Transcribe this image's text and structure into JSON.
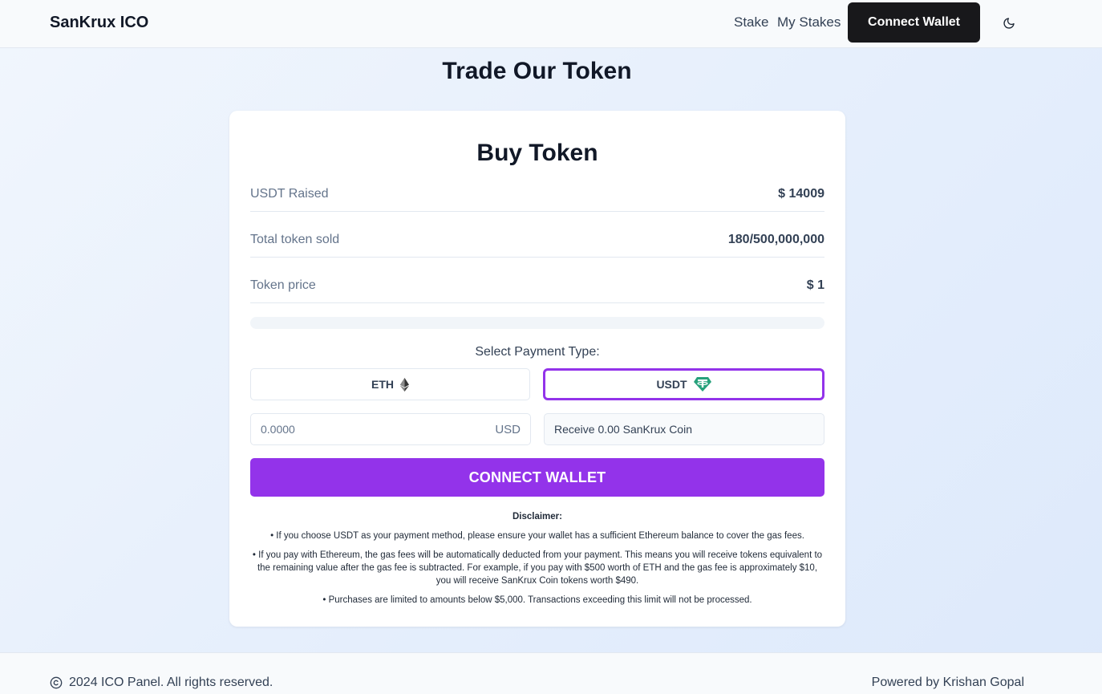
{
  "header": {
    "brand": "SanKrux ICO",
    "nav": {
      "stake": "Stake",
      "my_stakes": "My Stakes"
    },
    "connect_wallet_label": "Connect Wallet",
    "theme_icon": "moon-icon"
  },
  "page": {
    "heading": "Trade Our Token"
  },
  "card": {
    "title": "Buy Token",
    "stats": {
      "usdt_raised": {
        "label": "USDT Raised",
        "value": "$ 14009"
      },
      "tokens_sold": {
        "label": "Total token sold",
        "value": "180/500,000,000"
      },
      "token_price": {
        "label": "Token price",
        "value": "$ 1"
      }
    },
    "progress_fraction": 3.6e-07,
    "payment": {
      "label": "Select Payment Type:",
      "eth_label": "ETH",
      "eth_icon": "ethereum-icon",
      "usdt_label": "USDT",
      "usdt_icon": "tether-icon",
      "selected": "USDT"
    },
    "amount": {
      "placeholder": "0.0000",
      "unit": "USD"
    },
    "receive_text": "Receive 0.00 SanKrux Coin",
    "connect_label": "CONNECT WALLET",
    "disclaimer": {
      "title": "Disclaimer:",
      "items": [
        "• If you choose USDT as your payment method, please ensure your wallet has a sufficient Ethereum balance to cover the gas fees.",
        "• If you pay with Ethereum, the gas fees will be automatically deducted from your payment. This means you will receive tokens equivalent to the remaining value after the gas fee is subtracted. For example, if you pay with $500 worth of ETH and the gas fee is approximately $10, you will receive SanKrux Coin tokens worth $490.",
        "• Purchases are limited to amounts below $5,000. Transactions exceeding this limit will not be processed."
      ]
    }
  },
  "footer": {
    "copyright": "2024 ICO Panel. All rights reserved.",
    "copyright_icon": "copyright-icon",
    "powered_by": "Powered by Krishan Gopal"
  },
  "colors": {
    "accent": "#9333ea",
    "dark_button": "#18181b",
    "tether_green": "#26a17b"
  }
}
